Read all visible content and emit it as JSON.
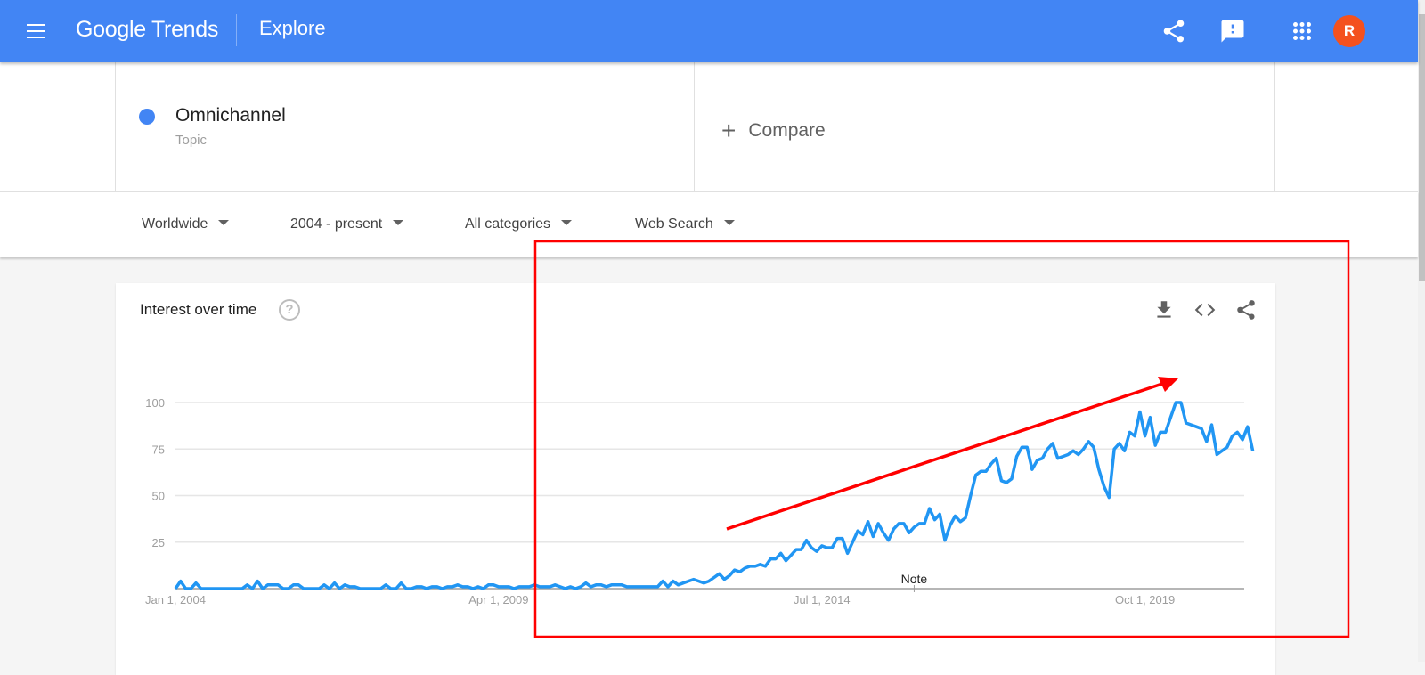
{
  "header": {
    "logo_text": "Google Trends",
    "page_title": "Explore",
    "avatar_initial": "R",
    "icons": [
      "menu-icon",
      "share-icon",
      "feedback-icon",
      "apps-icon"
    ],
    "brand_color": "#4285f4",
    "avatar_color": "#f4511e"
  },
  "search": {
    "term": "Omnichannel",
    "term_type": "Topic",
    "term_color": "#4285f4",
    "compare_label": "Compare"
  },
  "filters": [
    {
      "label": "Worldwide"
    },
    {
      "label": "2004 - present"
    },
    {
      "label": "All categories"
    },
    {
      "label": "Web Search"
    }
  ],
  "card": {
    "title": "Interest over time",
    "help_glyph": "?",
    "icons": [
      "download-icon",
      "embed-icon",
      "share-icon"
    ]
  },
  "annotation": {
    "color": "#ff0000",
    "shapes": [
      "highlight-rectangle",
      "trend-arrow"
    ]
  },
  "chart_data": {
    "type": "line",
    "title": "",
    "xlabel": "",
    "ylabel": "",
    "x_start": "2004-01",
    "x_interval": "month",
    "x_ticks": [
      "Jan 1, 2004",
      "Apr 1, 2009",
      "Jul 1, 2014",
      "Oct 1, 2019"
    ],
    "x_tick_dates": [
      "2004-01",
      "2009-04",
      "2014-07",
      "2019-10"
    ],
    "y_ticks": [
      25,
      50,
      75,
      100
    ],
    "ylim": [
      0,
      100
    ],
    "grid": true,
    "note_label": "Note",
    "note_date": "2016-01",
    "series": [
      {
        "color": "#2196f3",
        "values": [
          0,
          4,
          0,
          0,
          3,
          0,
          0,
          0,
          0,
          0,
          0,
          0,
          0,
          0,
          2,
          0,
          4,
          0,
          2,
          2,
          2,
          0,
          0,
          2,
          2,
          0,
          0,
          0,
          0,
          2,
          0,
          3,
          0,
          2,
          1,
          1,
          0,
          0,
          0,
          0,
          0,
          2,
          0,
          0,
          3,
          0,
          0,
          1,
          1,
          0,
          1,
          1,
          0,
          1,
          1,
          2,
          1,
          1,
          0,
          1,
          0,
          2,
          2,
          1,
          1,
          1,
          0,
          1,
          1,
          1,
          2,
          1,
          1,
          1,
          2,
          1,
          0,
          1,
          0,
          1,
          3,
          1,
          2,
          2,
          1,
          2,
          2,
          2,
          1,
          1,
          1,
          1,
          1,
          1,
          1,
          4,
          1,
          4,
          2,
          3,
          4,
          5,
          4,
          3,
          4,
          6,
          8,
          5,
          7,
          10,
          9,
          11,
          12,
          12,
          13,
          12,
          16,
          16,
          19,
          15,
          18,
          21,
          21,
          26,
          22,
          20,
          23,
          22,
          22,
          27,
          27,
          19,
          25,
          31,
          29,
          36,
          28,
          35,
          30,
          26,
          32,
          35,
          35,
          30,
          33,
          35,
          35,
          43,
          37,
          40,
          26,
          34,
          39,
          36,
          38,
          50,
          61,
          63,
          63,
          67,
          70,
          58,
          57,
          59,
          71,
          76,
          76,
          64,
          69,
          70,
          75,
          78,
          70,
          71,
          72,
          74,
          72,
          75,
          79,
          76,
          64,
          55,
          49,
          75,
          78,
          74,
          84,
          82,
          95,
          82,
          92,
          77,
          84,
          84,
          92,
          100,
          100,
          89,
          88,
          87,
          86,
          79,
          88,
          72,
          74,
          76,
          82,
          84,
          80,
          87,
          74
        ]
      }
    ]
  }
}
